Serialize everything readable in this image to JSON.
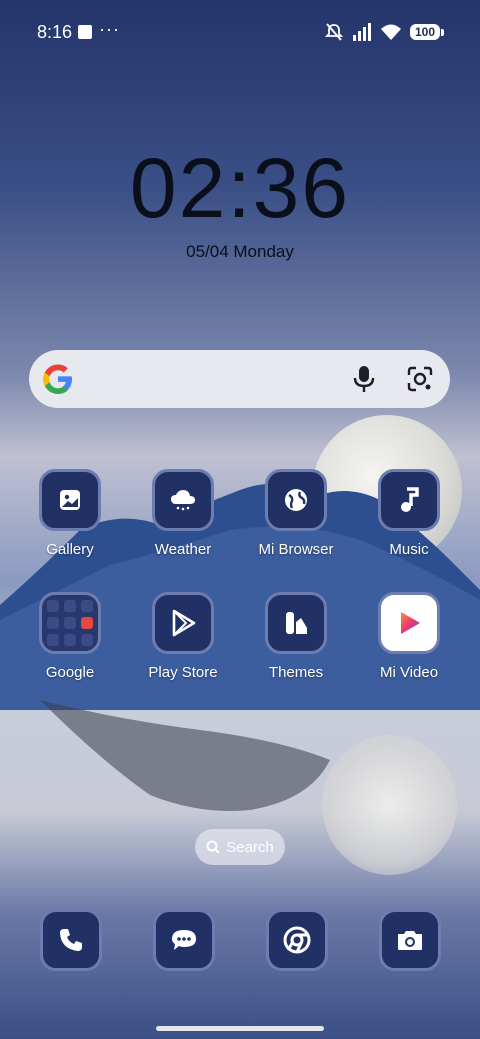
{
  "status_bar": {
    "time": "8:16",
    "more": "···",
    "battery": "100",
    "icons": [
      "notification-square-icon",
      "mute-icon",
      "signal-icon",
      "wifi-icon",
      "battery-icon"
    ]
  },
  "clock": {
    "time": "02:36",
    "date": "05/04 Monday"
  },
  "google_bar": {
    "icons": [
      "google-logo",
      "mic-icon",
      "google-lens-icon"
    ]
  },
  "apps": [
    {
      "label": "Gallery",
      "icon": "gallery-icon"
    },
    {
      "label": "Weather",
      "icon": "weather-icon"
    },
    {
      "label": "Mi Browser",
      "icon": "globe-icon"
    },
    {
      "label": "Music",
      "icon": "music-note-icon"
    },
    {
      "label": "Google",
      "icon": "folder-icon"
    },
    {
      "label": "Play Store",
      "icon": "play-store-icon"
    },
    {
      "label": "Themes",
      "icon": "themes-icon"
    },
    {
      "label": "Mi Video",
      "icon": "mi-video-icon"
    }
  ],
  "search_pill": {
    "label": "Search"
  },
  "dock": [
    "phone-icon",
    "messages-icon",
    "chrome-icon",
    "camera-icon"
  ],
  "colors": {
    "icon_bg": "#223165",
    "icon_border": "#6d7db0",
    "search_bar_bg": "#e8e9ef",
    "clock_text": "#0b0f1c"
  }
}
